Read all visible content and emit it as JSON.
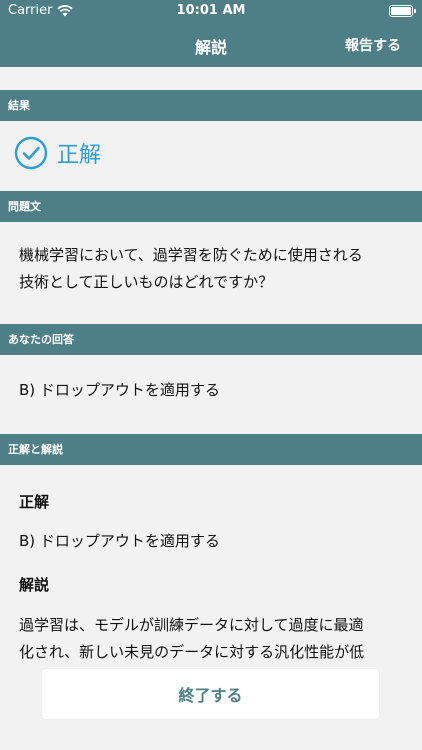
{
  "status_bar": {
    "carrier": "Carrier",
    "time": "10:01 AM",
    "wifi_icon": "wifi-icon",
    "battery_icon": "battery-icon"
  },
  "nav": {
    "title": "解説",
    "report_label": "報告する"
  },
  "sections": {
    "result": {
      "header": "結果",
      "icon": "check-circle-icon",
      "text": "正解"
    },
    "question": {
      "header": "問題文",
      "line1": "機械学習において、過学習を防ぐために使用される",
      "line2": "技術として正しいものはどれですか？"
    },
    "your_answer": {
      "header": "あなたの回答",
      "text": "B) ドロップアウトを適用する"
    },
    "explanation": {
      "header": "正解と解説",
      "correct_heading": "正解",
      "correct_text": "B) ドロップアウトを適用する",
      "explanation_heading": "解説",
      "line1": "過学習は、モデルが訓練データに対して過度に最適",
      "line2": "化され、新しい未見のデータに対する汎化性能が低"
    }
  },
  "footer": {
    "end_label": "終了する"
  },
  "colors": {
    "teal": "#4e7f86",
    "correct_blue": "#2a9fd6",
    "background": "#f2f2f2"
  }
}
